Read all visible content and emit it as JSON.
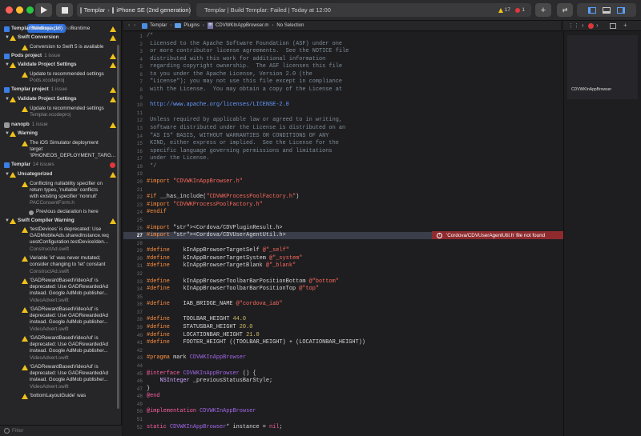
{
  "toolbar": {
    "scheme_project": "Templar",
    "scheme_device": "iPhone SE (2nd generation)",
    "status_text": "Templar | Build Templar: Failed | Today at 12:00",
    "warning_count": "17",
    "error_count": "1",
    "play_icon": "play-icon",
    "stop_icon": "stop-icon"
  },
  "navigator": {
    "tab_buildtime": "Buildtime (18)",
    "tab_runtime": "Runtime",
    "filter_placeholder": "Filter",
    "groups": [
      {
        "title": "Templar Workspace",
        "count": "1 issue"
      },
      {
        "title": "Swift Conversion"
      },
      {
        "title": "Conversion to Swift 5 is available"
      },
      {
        "title": "Pods project",
        "count": "1 issue"
      },
      {
        "title": "Validate Project Settings"
      },
      {
        "title": "Update to recommended settings"
      },
      {
        "title": "Pods.xcodeproj"
      },
      {
        "title": "Templar project",
        "count": "1 issue"
      },
      {
        "title": "Validate Project Settings"
      },
      {
        "title": "Update to recommended settings"
      },
      {
        "title": "Templar.xcodeproj"
      },
      {
        "title": "nanopb",
        "count": "1 issue"
      },
      {
        "title": "Warning"
      },
      {
        "title": "The iOS Simulator deployment"
      },
      {
        "title": "target"
      },
      {
        "title": "'IPHONEOS_DEPLOYMENT_TARG..."
      },
      {
        "title": "Templar",
        "count": "14 issues"
      },
      {
        "title": "Uncategorized"
      },
      {
        "title": "Conflicting nullability specifier on"
      },
      {
        "title": "return types, 'nullable' conflicts"
      },
      {
        "title": "with existing specifier 'nonnull'"
      },
      {
        "title": "PACConsentForm.h"
      },
      {
        "title": "Previous declaration is here"
      },
      {
        "title": "Swift Compiler Warning"
      },
      {
        "title": "'testDevices' is deprecated: Use"
      },
      {
        "title": "GADMobileAds.sharedInstance.req"
      },
      {
        "title": "uestConfiguration.testDeviceIden..."
      },
      {
        "title": "ConstructAd.swift"
      },
      {
        "title": "Variable 'id' was never mutated;"
      },
      {
        "title": "consider changing to 'let' constant"
      },
      {
        "title": "ConstructAd.swift"
      },
      {
        "title": "'GADRewardBasedVideoAd' is"
      },
      {
        "title": "deprecated: Use GADRewardedAd"
      },
      {
        "title": "instead. Google AdMob publisher..."
      },
      {
        "title": "VideoAdvert.swift"
      },
      {
        "title": "'GADRewardBasedVideoAd' is"
      },
      {
        "title": "deprecated: Use GADRewardedAd"
      },
      {
        "title": "instead. Google AdMob publisher..."
      },
      {
        "title": "VideoAdvert.swift"
      },
      {
        "title": "'GADRewardBasedVideoAd' is"
      },
      {
        "title": "deprecated: Use GADRewardedAd"
      },
      {
        "title": "instead. Google AdMob publisher..."
      },
      {
        "title": "VideoAdvert.swift"
      },
      {
        "title": "'GADRewardBasedVideoAd' is"
      },
      {
        "title": "deprecated: Use GADRewardedAd"
      },
      {
        "title": "instead. Google AdMob publisher..."
      },
      {
        "title": "VideoAdvert.swift"
      },
      {
        "title": "'bottomLayoutGuide' was"
      }
    ]
  },
  "jumpbar": {
    "crumb1": "Templar",
    "crumb2": "Plugins",
    "crumb3": "CDVWKInAppBrowser.m",
    "crumb4": "No Selection"
  },
  "editor": {
    "error_message": "'Cordova/CDVUserAgentUtil.h' file not found",
    "minimap_label": "CDVWKInAppBrowser",
    "lines": [
      {
        "n": "1",
        "t": "/*"
      },
      {
        "n": "2",
        "t": " Licensed to the Apache Software Foundation (ASF) under one"
      },
      {
        "n": "3",
        "t": " or more contributor license agreements.  See the NOTICE file"
      },
      {
        "n": "4",
        "t": " distributed with this work for additional information"
      },
      {
        "n": "5",
        "t": " regarding copyright ownership.  The ASF licenses this file"
      },
      {
        "n": "6",
        "t": " to you under the Apache License, Version 2.0 (the"
      },
      {
        "n": "7",
        "t": " \"License\"); you may not use this file except in compliance"
      },
      {
        "n": "8",
        "t": " with the License.  You may obtain a copy of the License at"
      },
      {
        "n": "9",
        "t": ""
      },
      {
        "n": "10",
        "t": " http://www.apache.org/licenses/LICENSE-2.0"
      },
      {
        "n": "11",
        "t": ""
      },
      {
        "n": "12",
        "t": " Unless required by applicable law or agreed to in writing,"
      },
      {
        "n": "13",
        "t": " software distributed under the License is distributed on an"
      },
      {
        "n": "14",
        "t": " \"AS IS\" BASIS, WITHOUT WARRANTIES OR CONDITIONS OF ANY"
      },
      {
        "n": "15",
        "t": " KIND, either express or implied.  See the License for the"
      },
      {
        "n": "16",
        "t": " specific language governing permissions and limitations"
      },
      {
        "n": "17",
        "t": " under the License."
      },
      {
        "n": "18",
        "t": " */"
      },
      {
        "n": "19",
        "t": ""
      },
      {
        "n": "20",
        "t": "#import \"CDVWKInAppBrowser.h\""
      },
      {
        "n": "21",
        "t": ""
      },
      {
        "n": "22",
        "t": "#if __has_include(\"CDVWKProcessPoolFactory.h\")"
      },
      {
        "n": "23",
        "t": "#import \"CDVWKProcessPoolFactory.h\""
      },
      {
        "n": "24",
        "t": "#endif"
      },
      {
        "n": "25",
        "t": ""
      },
      {
        "n": "26",
        "t": "#import <Cordova/CDVPluginResult.h>"
      },
      {
        "n": "27",
        "t": "#import <Cordova/CDVUserAgentUtil.h>"
      },
      {
        "n": "28",
        "t": ""
      },
      {
        "n": "29",
        "t": "#define    kInAppBrowserTargetSelf @\"_self\""
      },
      {
        "n": "30",
        "t": "#define    kInAppBrowserTargetSystem @\"_system\""
      },
      {
        "n": "31",
        "t": "#define    kInAppBrowserTargetBlank @\"_blank\""
      },
      {
        "n": "32",
        "t": ""
      },
      {
        "n": "33",
        "t": "#define    kInAppBrowserToolbarBarPositionBottom @\"bottom\""
      },
      {
        "n": "34",
        "t": "#define    kInAppBrowserToolbarBarPositionTop @\"top\""
      },
      {
        "n": "35",
        "t": ""
      },
      {
        "n": "36",
        "t": "#define    IAB_BRIDGE_NAME @\"cordova_iab\""
      },
      {
        "n": "37",
        "t": ""
      },
      {
        "n": "38",
        "t": "#define    TOOLBAR_HEIGHT 44.0"
      },
      {
        "n": "39",
        "t": "#define    STATUSBAR_HEIGHT 20.0"
      },
      {
        "n": "40",
        "t": "#define    LOCATIONBAR_HEIGHT 21.0"
      },
      {
        "n": "41",
        "t": "#define    FOOTER_HEIGHT ((TOOLBAR_HEIGHT) + (LOCATIONBAR_HEIGHT))"
      },
      {
        "n": "42",
        "t": ""
      },
      {
        "n": "43",
        "t": "#pragma mark CDVWKInAppBrowser"
      },
      {
        "n": "44",
        "t": ""
      },
      {
        "n": "45",
        "t": "@interface CDVWKInAppBrowser () {"
      },
      {
        "n": "46",
        "t": "    NSInteger _previousStatusBarStyle;"
      },
      {
        "n": "47",
        "t": "}"
      },
      {
        "n": "48",
        "t": "@end"
      },
      {
        "n": "49",
        "t": ""
      },
      {
        "n": "50",
        "t": "@implementation CDVWKInAppBrowser"
      },
      {
        "n": "51",
        "t": ""
      },
      {
        "n": "52",
        "t": "static CDVWKInAppBrowser* instance = nil;"
      }
    ]
  }
}
